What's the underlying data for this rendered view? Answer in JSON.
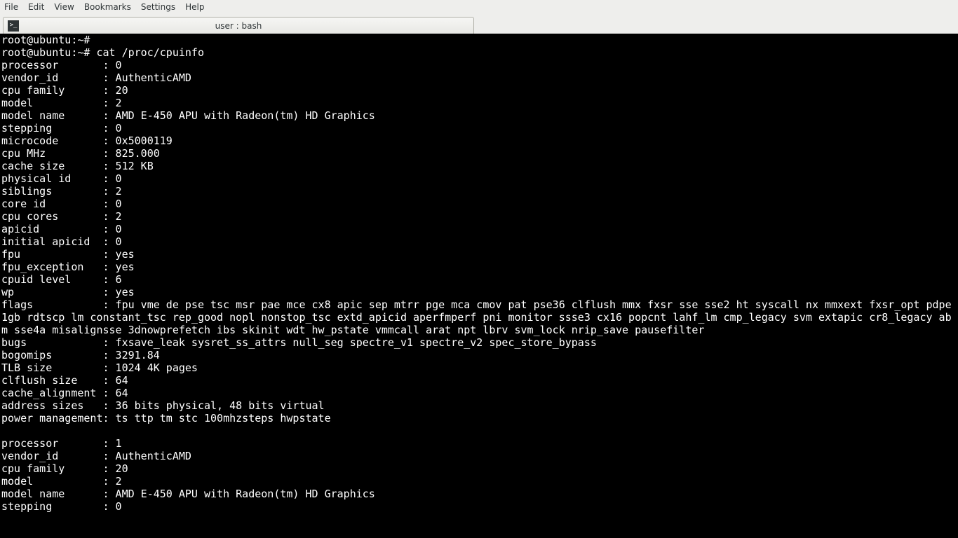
{
  "menubar": {
    "items": [
      "File",
      "Edit",
      "View",
      "Bookmarks",
      "Settings",
      "Help"
    ]
  },
  "tab": {
    "title": "user : bash"
  },
  "terminal": {
    "prompt": "root@ubuntu:~#",
    "blank_command": "",
    "command": "cat /proc/cpuinfo",
    "cpu0": [
      [
        "processor",
        "0"
      ],
      [
        "vendor_id",
        "AuthenticAMD"
      ],
      [
        "cpu family",
        "20"
      ],
      [
        "model",
        "2"
      ],
      [
        "model name",
        "AMD E-450 APU with Radeon(tm) HD Graphics"
      ],
      [
        "stepping",
        "0"
      ],
      [
        "microcode",
        "0x5000119"
      ],
      [
        "cpu MHz",
        "825.000"
      ],
      [
        "cache size",
        "512 KB"
      ],
      [
        "physical id",
        "0"
      ],
      [
        "siblings",
        "2"
      ],
      [
        "core id",
        "0"
      ],
      [
        "cpu cores",
        "2"
      ],
      [
        "apicid",
        "0"
      ],
      [
        "initial apicid",
        "0"
      ],
      [
        "fpu",
        "yes"
      ],
      [
        "fpu_exception",
        "yes"
      ],
      [
        "cpuid level",
        "6"
      ],
      [
        "wp",
        "yes"
      ],
      [
        "flags",
        "fpu vme de pse tsc msr pae mce cx8 apic sep mtrr pge mca cmov pat pse36 clflush mmx fxsr sse sse2 ht syscall nx mmxext fxsr_opt pdpe1gb rdtscp lm constant_tsc rep_good nopl nonstop_tsc extd_apicid aperfmperf pni monitor ssse3 cx16 popcnt lahf_lm cmp_legacy svm extapic cr8_legacy abm sse4a misalignsse 3dnowprefetch ibs skinit wdt hw_pstate vmmcall arat npt lbrv svm_lock nrip_save pausefilter"
      ],
      [
        "bugs",
        "fxsave_leak sysret_ss_attrs null_seg spectre_v1 spectre_v2 spec_store_bypass"
      ],
      [
        "bogomips",
        "3291.84"
      ],
      [
        "TLB size",
        "1024 4K pages"
      ],
      [
        "clflush size",
        "64"
      ],
      [
        "cache_alignment",
        "64"
      ],
      [
        "address sizes",
        "36 bits physical, 48 bits virtual"
      ],
      [
        "power management",
        "ts ttp tm stc 100mhzsteps hwpstate"
      ]
    ],
    "cpu1": [
      [
        "processor",
        "1"
      ],
      [
        "vendor_id",
        "AuthenticAMD"
      ],
      [
        "cpu family",
        "20"
      ],
      [
        "model",
        "2"
      ],
      [
        "model name",
        "AMD E-450 APU with Radeon(tm) HD Graphics"
      ],
      [
        "stepping",
        "0"
      ]
    ]
  }
}
